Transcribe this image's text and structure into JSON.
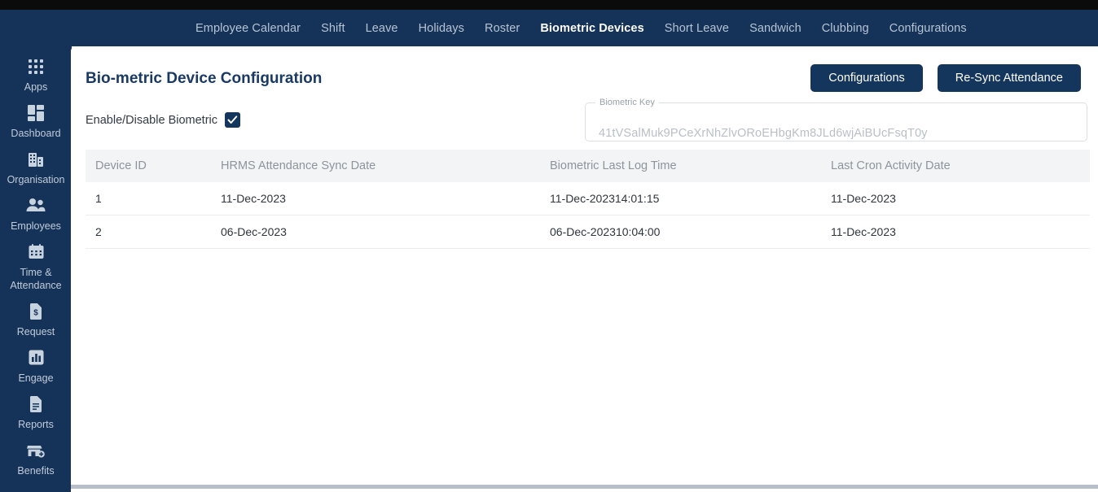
{
  "topnav": {
    "items": [
      {
        "label": "Employee Calendar",
        "active": false
      },
      {
        "label": "Shift",
        "active": false
      },
      {
        "label": "Leave",
        "active": false
      },
      {
        "label": "Holidays",
        "active": false
      },
      {
        "label": "Roster",
        "active": false
      },
      {
        "label": "Biometric Devices",
        "active": true
      },
      {
        "label": "Short Leave",
        "active": false
      },
      {
        "label": "Sandwich",
        "active": false
      },
      {
        "label": "Clubbing",
        "active": false
      },
      {
        "label": "Configurations",
        "active": false
      }
    ]
  },
  "sidebar": {
    "items": [
      {
        "label": "Apps",
        "icon": "grid-apps-icon"
      },
      {
        "label": "Dashboard",
        "icon": "dashboard-tiles-icon"
      },
      {
        "label": "Organisation",
        "icon": "building-icon"
      },
      {
        "label": "Employees",
        "icon": "people-icon"
      },
      {
        "label": "Time &\nAttendance",
        "icon": "calendar-icon"
      },
      {
        "label": "Request",
        "icon": "money-document-icon"
      },
      {
        "label": "Engage",
        "icon": "bar-chart-icon"
      },
      {
        "label": "Reports",
        "icon": "document-lines-icon"
      },
      {
        "label": "Benefits",
        "icon": "store-plus-icon"
      }
    ]
  },
  "page": {
    "title": "Bio-metric Device Configuration",
    "buttons": {
      "configurations": "Configurations",
      "resync": "Re-Sync Attendance"
    },
    "enable_biometric": {
      "label": "Enable/Disable Biometric",
      "checked": true,
      "icon": "checkmark-icon"
    },
    "biometric_key": {
      "legend": "Biometric Key",
      "value": "41tVSalMuk9PCeXrNhZlvORoEHbgKm8JLd6wjAiBUcFsqT0y"
    }
  },
  "table": {
    "columns": [
      "Device ID",
      "HRMS Attendance Sync Date",
      "Biometric Last Log Time",
      "Last Cron Activity Date"
    ],
    "rows": [
      {
        "device_id": "1",
        "hrms_sync_date": "11-Dec-2023",
        "last_log_time": "11-Dec-202314:01:15",
        "last_cron_date": "11-Dec-2023"
      },
      {
        "device_id": "2",
        "hrms_sync_date": "06-Dec-2023",
        "last_log_time": "06-Dec-202310:04:00",
        "last_cron_date": "11-Dec-2023"
      }
    ]
  },
  "colors": {
    "navy": "#153258",
    "button": "#15365c",
    "title": "#1a3a63",
    "header_bg": "#f3f4f5",
    "top_strip": "#0b0b0b"
  }
}
